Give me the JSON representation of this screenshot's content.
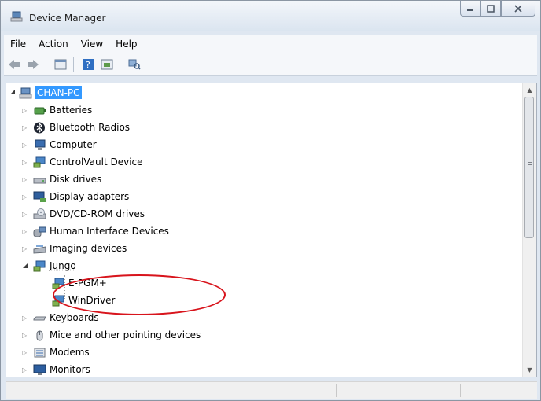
{
  "window": {
    "title": "Device Manager"
  },
  "menu": [
    "File",
    "Action",
    "View",
    "Help"
  ],
  "toolbar": [
    "back-icon",
    "forward-icon",
    "properties-icon",
    "help-icon",
    "update-driver-icon",
    "scan-hardware-icon"
  ],
  "tree": {
    "root": "CHAN-PC",
    "items": [
      {
        "label": "Batteries",
        "icon": "battery-icon"
      },
      {
        "label": "Bluetooth Radios",
        "icon": "bluetooth-icon"
      },
      {
        "label": "Computer",
        "icon": "computer-icon"
      },
      {
        "label": "ControlVault Device",
        "icon": "device-icon"
      },
      {
        "label": "Disk drives",
        "icon": "disk-icon"
      },
      {
        "label": "Display adapters",
        "icon": "display-icon"
      },
      {
        "label": "DVD/CD-ROM drives",
        "icon": "dvd-icon"
      },
      {
        "label": "Human Interface Devices",
        "icon": "hid-icon"
      },
      {
        "label": "Imaging devices",
        "icon": "imaging-icon"
      },
      {
        "label": "Jungo",
        "icon": "device-icon",
        "expanded": true,
        "children": [
          "E-PGM+",
          "WinDriver"
        ]
      },
      {
        "label": "Keyboards",
        "icon": "keyboard-icon"
      },
      {
        "label": "Mice and other pointing devices",
        "icon": "mouse-icon"
      },
      {
        "label": "Modems",
        "icon": "modem-icon"
      },
      {
        "label": "Monitors",
        "icon": "monitor-icon"
      }
    ]
  },
  "colors": {
    "selection": "#3399ff",
    "annotation": "#d8141c"
  }
}
